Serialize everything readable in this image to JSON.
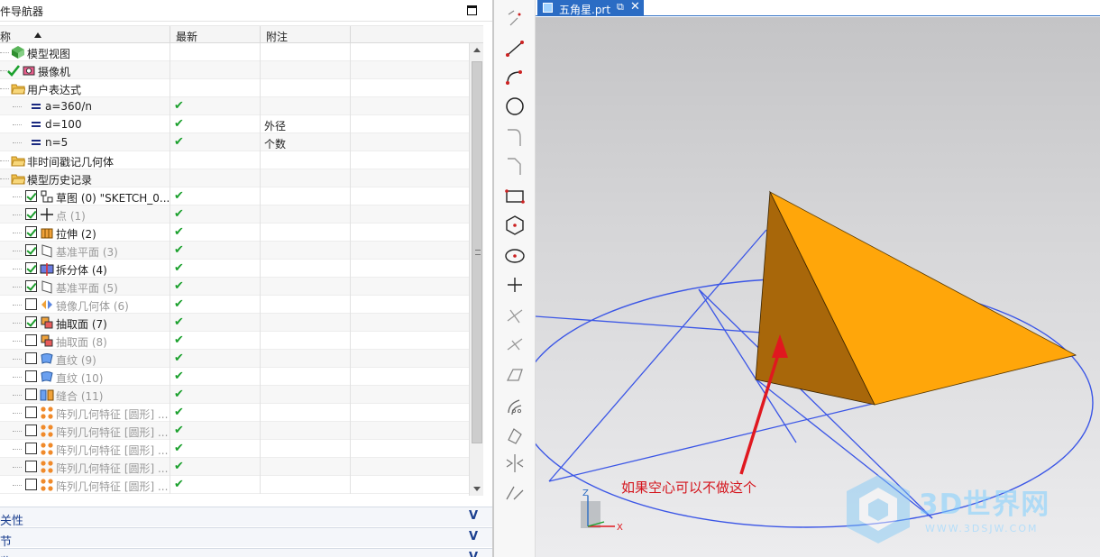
{
  "navigator": {
    "title": "部件导航器",
    "columns": {
      "name": "名称",
      "latest": "最新",
      "note": "附注"
    },
    "rows": [
      {
        "label": "模型视图",
        "indent": 0,
        "icon": "model-view-icon",
        "checkbox": "none",
        "latest": "",
        "note": "",
        "grey": false
      },
      {
        "label": "摄像机",
        "indent": 0,
        "icon": "camera-icon",
        "checkbox": "check",
        "latest": "",
        "note": "",
        "grey": false
      },
      {
        "label": "用户表达式",
        "indent": 0,
        "icon": "folder-icon",
        "checkbox": "none",
        "latest": "",
        "note": "",
        "grey": false
      },
      {
        "label": "a=360/n",
        "indent": 1,
        "icon": "expression-icon",
        "checkbox": "none",
        "latest": "✔",
        "note": "",
        "grey": false
      },
      {
        "label": "d=100",
        "indent": 1,
        "icon": "expression-icon",
        "checkbox": "none",
        "latest": "✔",
        "note": "外径",
        "grey": false
      },
      {
        "label": "n=5",
        "indent": 1,
        "icon": "expression-icon",
        "checkbox": "none",
        "latest": "✔",
        "note": "个数",
        "grey": false
      },
      {
        "label": "非时间戳记几何体",
        "indent": 0,
        "icon": "folder-icon",
        "checkbox": "none",
        "latest": "",
        "note": "",
        "grey": false
      },
      {
        "label": "模型历史记录",
        "indent": 0,
        "icon": "folder-icon",
        "checkbox": "none",
        "latest": "",
        "note": "",
        "grey": false
      },
      {
        "label": "草图 (0) \"SKETCH_0...",
        "indent": 1,
        "icon": "sketch-icon",
        "checkbox": "on",
        "latest": "✔",
        "note": "",
        "grey": false
      },
      {
        "label": "点 (1)",
        "indent": 1,
        "icon": "point-icon",
        "checkbox": "on",
        "latest": "✔",
        "note": "",
        "grey": true
      },
      {
        "label": "拉伸 (2)",
        "indent": 1,
        "icon": "extrude-icon",
        "checkbox": "on",
        "latest": "✔",
        "note": "",
        "grey": false
      },
      {
        "label": "基准平面 (3)",
        "indent": 1,
        "icon": "datum-plane-icon",
        "checkbox": "on",
        "latest": "✔",
        "note": "",
        "grey": true
      },
      {
        "label": "拆分体 (4)",
        "indent": 1,
        "icon": "split-body-icon",
        "checkbox": "on",
        "latest": "✔",
        "note": "",
        "grey": false
      },
      {
        "label": "基准平面 (5)",
        "indent": 1,
        "icon": "datum-plane-icon",
        "checkbox": "on",
        "latest": "✔",
        "note": "",
        "grey": true
      },
      {
        "label": "镜像几何体 (6)",
        "indent": 1,
        "icon": "mirror-icon",
        "checkbox": "off",
        "latest": "✔",
        "note": "",
        "grey": true
      },
      {
        "label": "抽取面 (7)",
        "indent": 1,
        "icon": "extract-face-icon",
        "checkbox": "on",
        "latest": "✔",
        "note": "",
        "grey": false
      },
      {
        "label": "抽取面 (8)",
        "indent": 1,
        "icon": "extract-face-icon",
        "checkbox": "off",
        "latest": "✔",
        "note": "",
        "grey": true
      },
      {
        "label": "直纹 (9)",
        "indent": 1,
        "icon": "ruled-icon",
        "checkbox": "off",
        "latest": "✔",
        "note": "",
        "grey": true
      },
      {
        "label": "直纹 (10)",
        "indent": 1,
        "icon": "ruled-icon",
        "checkbox": "off",
        "latest": "✔",
        "note": "",
        "grey": true
      },
      {
        "label": "缝合 (11)",
        "indent": 1,
        "icon": "sew-icon",
        "checkbox": "off",
        "latest": "✔",
        "note": "",
        "grey": true
      },
      {
        "label": "阵列几何特征 [圆形] ...",
        "indent": 1,
        "icon": "pattern-icon",
        "checkbox": "off",
        "latest": "✔",
        "note": "",
        "grey": true
      },
      {
        "label": "阵列几何特征 [圆形] ...",
        "indent": 1,
        "icon": "pattern-icon",
        "checkbox": "off",
        "latest": "✔",
        "note": "",
        "grey": true
      },
      {
        "label": "阵列几何特征 [圆形] ...",
        "indent": 1,
        "icon": "pattern-icon",
        "checkbox": "off",
        "latest": "✔",
        "note": "",
        "grey": true
      },
      {
        "label": "阵列几何特征 [圆形] ...",
        "indent": 1,
        "icon": "pattern-icon",
        "checkbox": "off",
        "latest": "✔",
        "note": "",
        "grey": true
      },
      {
        "label": "阵列几何特征 [圆形] ...",
        "indent": 1,
        "icon": "pattern-icon",
        "checkbox": "off",
        "latest": "✔",
        "note": "",
        "grey": true
      }
    ],
    "panels": [
      "相关性",
      "细节",
      "预览"
    ]
  },
  "tab": {
    "label": "五角星.prt"
  },
  "viewport": {
    "annotation": "如果空心可以不做这个",
    "watermark_text": "3D世界网",
    "watermark_url": "WWW.3DSJW.COM",
    "axis_labels": {
      "z": "Z",
      "x": "X"
    }
  },
  "colors": {
    "accent": "#2b6cc4",
    "checkmark": "#1aa02c",
    "panel_text": "#1b3f8f",
    "wire": "#3b56e6",
    "solid_light": "#ffa60a",
    "solid_dark": "#a8670a",
    "annotation": "#d4141c"
  },
  "toolbar": [
    "profile-icon",
    "line-icon",
    "arc-icon",
    "circle-icon",
    "fillet-icon",
    "chamfer-icon",
    "rectangle-icon",
    "polygon-icon",
    "ellipse-icon",
    "point-icon",
    "quick-trim-icon",
    "quick-extend-icon",
    "make-corner-icon",
    "offset-curve-icon",
    "pattern-curve-icon",
    "mirror-curve-icon",
    "constraints-icon"
  ]
}
